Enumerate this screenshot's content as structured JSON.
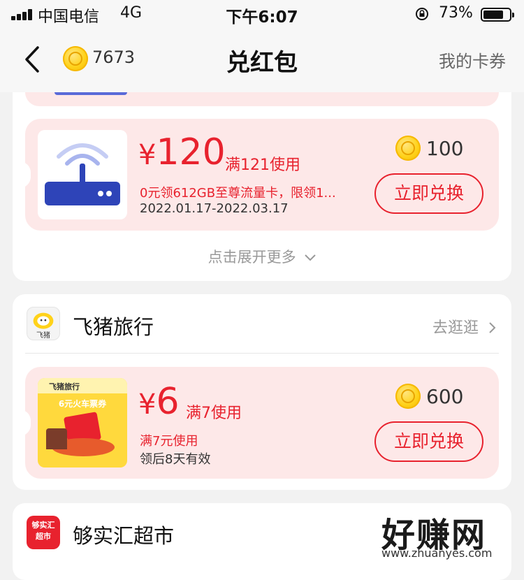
{
  "status_bar": {
    "carrier": "中国电信",
    "network": "4G",
    "time": "下午6:07",
    "battery": "73%"
  },
  "nav": {
    "balance": "7673",
    "title": "兑红包",
    "my_coupons": "我的卡券"
  },
  "sections": [
    {
      "coupon": {
        "currency": "¥",
        "amount": "120",
        "condition": "满121使用",
        "description": "0元领612GB至尊流量卡，限领1...",
        "validity": "2022.01.17-2022.03.17",
        "cost": "100",
        "redeem_label": "立即兑换",
        "thumb_icon": "router-icon"
      },
      "expand_label": "点击展开更多"
    },
    {
      "shop_name": "飞猪旅行",
      "go_label": "去逛逛",
      "logo_text": "飞猪",
      "coupon": {
        "currency": "¥",
        "amount": "6",
        "condition": "满7使用",
        "description": "满7元使用",
        "validity": "领后8天有效",
        "cost": "600",
        "redeem_label": "立即兑换",
        "thumb_title": "飞猪旅行",
        "thumb_caption": "6元火车票券"
      }
    },
    {
      "shop_name": "够实汇超市",
      "logo_text": "够实汇超市"
    }
  ],
  "watermark": {
    "text": "好赚网",
    "url": "www.zhuanyes.com"
  },
  "colors": {
    "accent": "#e8222e",
    "coupon_bg": "#fde8e8",
    "coin": "#ffd21a"
  }
}
